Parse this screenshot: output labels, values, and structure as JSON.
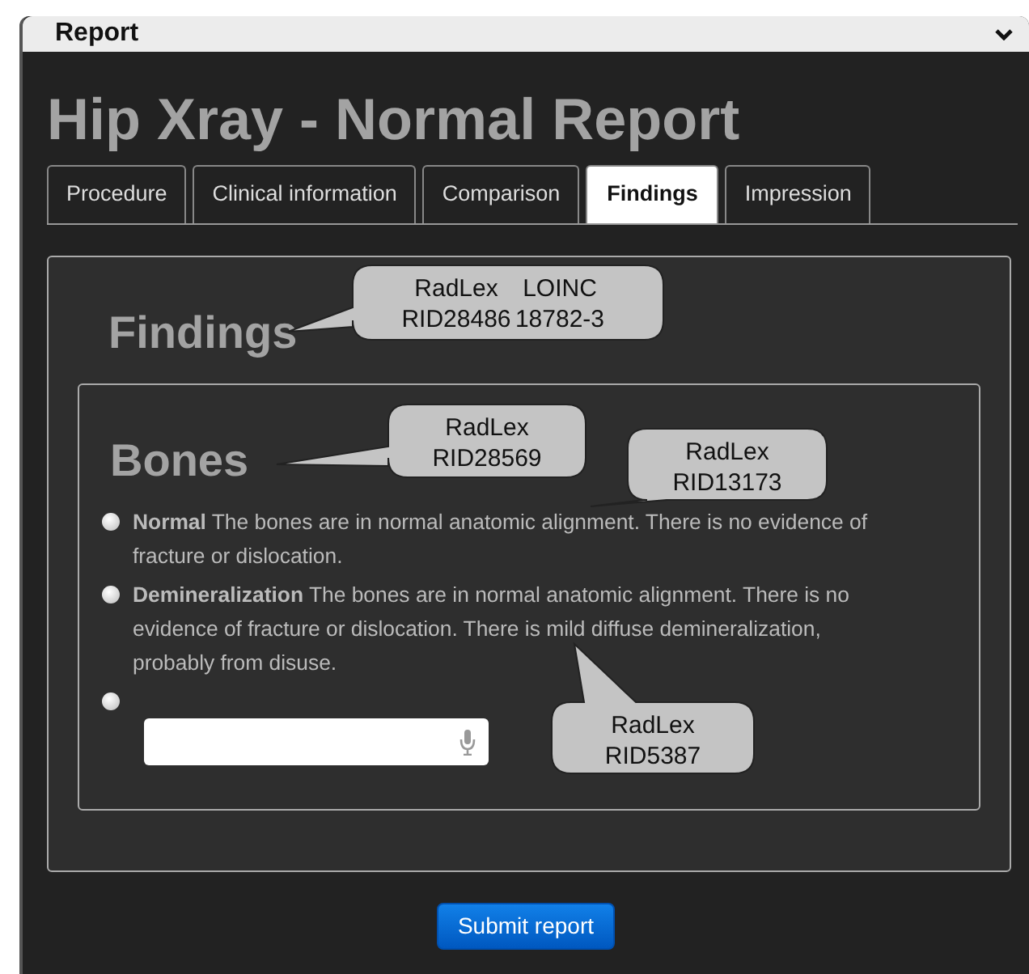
{
  "panel": {
    "title": "Report",
    "collapsed": false
  },
  "page_title": "Hip Xray - Normal Report",
  "tabs": [
    {
      "label": "Procedure",
      "selected": false
    },
    {
      "label": "Clinical information",
      "selected": false
    },
    {
      "label": "Comparison",
      "selected": false
    },
    {
      "label": "Findings",
      "selected": true
    },
    {
      "label": "Impression",
      "selected": false
    }
  ],
  "section": {
    "title": "Findings",
    "subsection": {
      "title": "Bones",
      "options": [
        {
          "kind": "text",
          "label": "Normal",
          "text": "The bones are in normal anatomic alignment. There is no evidence of fracture or dislocation.",
          "selected": false
        },
        {
          "kind": "text",
          "label": "Demineralization",
          "text": "The bones are in normal anatomic alignment. There is no evidence of fracture or dislocation. There is mild diffuse demineralization, probably from disuse.",
          "selected": false
        },
        {
          "kind": "input",
          "selected": false
        }
      ]
    }
  },
  "submit_button": "Submit report",
  "callouts": [
    {
      "codes": [
        {
          "system": "RadLex",
          "code": "RID28486"
        },
        {
          "system": "LOINC",
          "code": "18782-3"
        }
      ]
    },
    {
      "codes": [
        {
          "system": "RadLex",
          "code": "RID28569"
        }
      ]
    },
    {
      "codes": [
        {
          "system": "RadLex",
          "code": "RID13173"
        }
      ]
    },
    {
      "codes": [
        {
          "system": "RadLex",
          "code": "RID5387"
        }
      ]
    }
  ]
}
